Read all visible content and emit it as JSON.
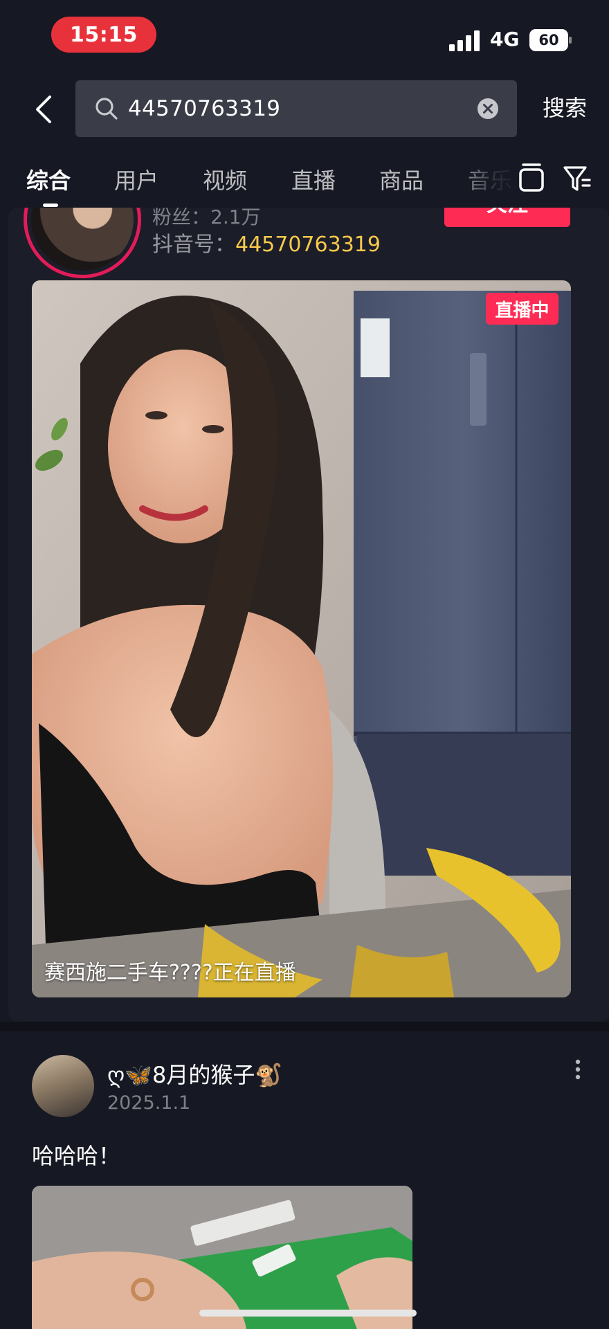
{
  "status_bar": {
    "time": "15:15",
    "network": "4G",
    "battery": "60"
  },
  "search": {
    "query": "44570763319",
    "submit_label": "搜索"
  },
  "tabs": [
    {
      "label": "综合"
    },
    {
      "label": "用户"
    },
    {
      "label": "视频"
    },
    {
      "label": "直播"
    },
    {
      "label": "商品"
    },
    {
      "label": "音乐"
    }
  ],
  "user_card": {
    "fans": "粉丝：2.1万",
    "douyin_id_label": "抖音号：",
    "douyin_id": "44570763319",
    "follow_label": "关注",
    "live_badge": "直播中",
    "live_caption": "赛西施二手车????正在直播"
  },
  "post": {
    "author": "ღ🦋8月的猴子🐒",
    "date": "2025.1.1",
    "text": "哈哈哈！"
  },
  "colors": {
    "accent": "#fe2c55",
    "id_highlight": "#f8c94a",
    "time_pill": "#e8323b"
  },
  "icons": [
    "back-arrow-icon",
    "search-icon",
    "clear-icon",
    "layout-icon",
    "filter-icon",
    "more-vertical-icon",
    "signal-icon",
    "battery-icon"
  ]
}
